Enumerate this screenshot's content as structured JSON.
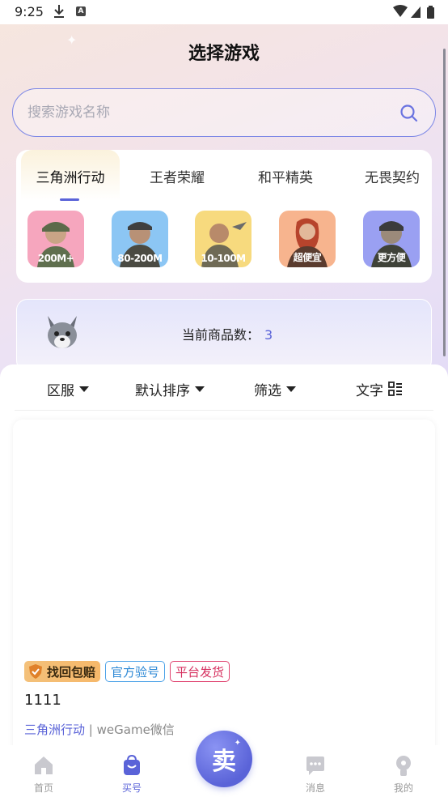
{
  "status_bar": {
    "time": "9:25"
  },
  "header": {
    "title": "选择游戏"
  },
  "search": {
    "placeholder": "搜索游戏名称"
  },
  "game_tabs": [
    {
      "label": "三角洲行动",
      "active": true
    },
    {
      "label": "王者荣耀",
      "active": false
    },
    {
      "label": "和平精英",
      "active": false
    },
    {
      "label": "无畏契约",
      "active": false
    }
  ],
  "category_badges": [
    {
      "label": "200M+",
      "color": "#f08aa8"
    },
    {
      "label": "80-200M",
      "color": "#6fb4ef"
    },
    {
      "label": "10-100M",
      "color": "#f2c25a"
    },
    {
      "label": "超便宜",
      "color": "#f29a6b"
    },
    {
      "label": "更方便",
      "color": "#7c83ee"
    }
  ],
  "count_card": {
    "label": "当前商品数：",
    "value": "3"
  },
  "filters": {
    "region": "区服",
    "sort": "默认排序",
    "filter": "筛选",
    "view": "文字"
  },
  "product": {
    "tags": {
      "guarantee": "找回包赔",
      "verified": "官方验号",
      "delivery": "平台发货"
    },
    "title": "1111",
    "game": "三角洲行动",
    "separator": "|",
    "platform": "weGame微信"
  },
  "bottom_nav": {
    "home": "首页",
    "buy": "买号",
    "sell": "卖",
    "messages": "消息",
    "mine": "我的"
  },
  "colors": {
    "accent": "#5a63d8",
    "tag_blue": "#2f8ad6",
    "tag_pink": "#d6305f"
  }
}
